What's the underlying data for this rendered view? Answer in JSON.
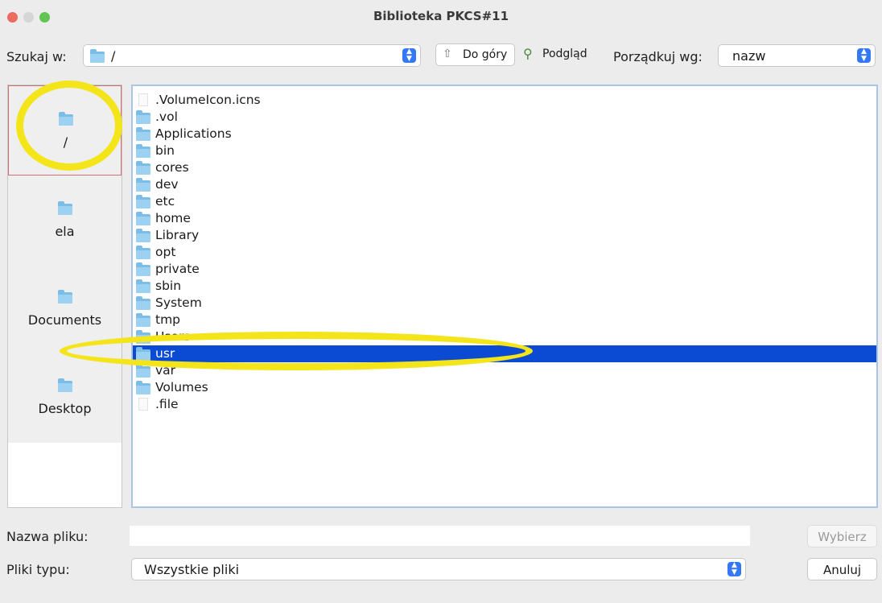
{
  "window": {
    "title": "Biblioteka PKCS#11"
  },
  "toolbar": {
    "look_in_label": "Szukaj w:",
    "look_in_value": "/",
    "up_label": "Do góry",
    "preview_label": "Podgląd",
    "sort_label": "Porządkuj wg:",
    "sort_value": "nazw"
  },
  "sidebar": {
    "items": [
      {
        "label": "/",
        "icon": "folder-icon"
      },
      {
        "label": "ela",
        "icon": "folder-icon"
      },
      {
        "label": "Documents",
        "icon": "folder-icon"
      },
      {
        "label": "Desktop",
        "icon": "folder-icon"
      }
    ]
  },
  "files": [
    {
      "name": ".VolumeIcon.icns",
      "type": "file"
    },
    {
      "name": ".vol",
      "type": "folder"
    },
    {
      "name": "Applications",
      "type": "folder"
    },
    {
      "name": "bin",
      "type": "folder"
    },
    {
      "name": "cores",
      "type": "folder"
    },
    {
      "name": "dev",
      "type": "folder"
    },
    {
      "name": "etc",
      "type": "folder"
    },
    {
      "name": "home",
      "type": "folder"
    },
    {
      "name": "Library",
      "type": "folder"
    },
    {
      "name": "opt",
      "type": "folder"
    },
    {
      "name": "private",
      "type": "folder"
    },
    {
      "name": "sbin",
      "type": "folder"
    },
    {
      "name": "System",
      "type": "folder"
    },
    {
      "name": "tmp",
      "type": "folder"
    },
    {
      "name": "Users",
      "type": "folder"
    },
    {
      "name": "usr",
      "type": "folder",
      "selected": true
    },
    {
      "name": "var",
      "type": "folder"
    },
    {
      "name": "Volumes",
      "type": "folder"
    },
    {
      "name": ".file",
      "type": "file"
    }
  ],
  "footer": {
    "filename_label": "Nazwa pliku:",
    "filename_value": "",
    "filetype_label": "Pliki typu:",
    "filetype_value": "Wszystkie pliki",
    "choose_label": "Wybierz",
    "cancel_label": "Anuluj"
  },
  "colors": {
    "selection": "#0b4bd4",
    "highlight": "#f4e51b",
    "accent": "#3478f6"
  }
}
